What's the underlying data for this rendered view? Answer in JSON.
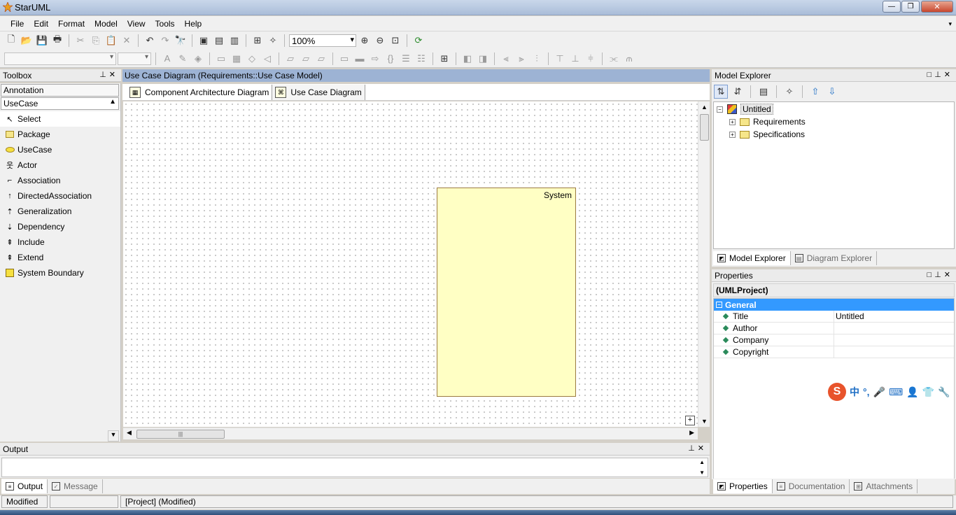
{
  "window": {
    "title": "StarUML",
    "minimize_glyph": "—",
    "maximize_glyph": "❐",
    "close_glyph": "✕"
  },
  "menu": [
    "File",
    "Edit",
    "Format",
    "Model",
    "View",
    "Tools",
    "Help"
  ],
  "menu_overflow_glyph": "▾",
  "toolbar": {
    "zoom": "100%"
  },
  "toolbox": {
    "title": "Toolbox",
    "sections": [
      "Annotation",
      "UseCase"
    ],
    "tools": [
      "Select",
      "Package",
      "UseCase",
      "Actor",
      "Association",
      "DirectedAssociation",
      "Generalization",
      "Dependency",
      "Include",
      "Extend",
      "System Boundary"
    ]
  },
  "diagram": {
    "header": "Use Case Diagram (Requirements::Use Case Model)",
    "tabs": [
      "Component Architecture Diagram",
      "Use Case Diagram"
    ],
    "system_label": "System"
  },
  "output": {
    "title": "Output",
    "tabs": [
      "Output",
      "Message"
    ]
  },
  "explorer": {
    "title": "Model Explorer",
    "root": "Untitled",
    "children": [
      "Requirements",
      "Specifications"
    ],
    "tabs": [
      "Model Explorer",
      "Diagram Explorer"
    ]
  },
  "properties": {
    "title": "Properties",
    "kind": "(UMLProject)",
    "group": "General",
    "rows": [
      {
        "key": "Title",
        "value": "Untitled"
      },
      {
        "key": "Author",
        "value": ""
      },
      {
        "key": "Company",
        "value": ""
      },
      {
        "key": "Copyright",
        "value": ""
      }
    ],
    "tabs": [
      "Properties",
      "Documentation",
      "Attachments"
    ]
  },
  "ime": {
    "logo": "S",
    "items": [
      "中",
      "°,",
      "🎤",
      "⌨",
      "👤",
      "👕",
      "🔧"
    ]
  },
  "status": [
    "Modified",
    "",
    "[Project]  (Modified)"
  ]
}
